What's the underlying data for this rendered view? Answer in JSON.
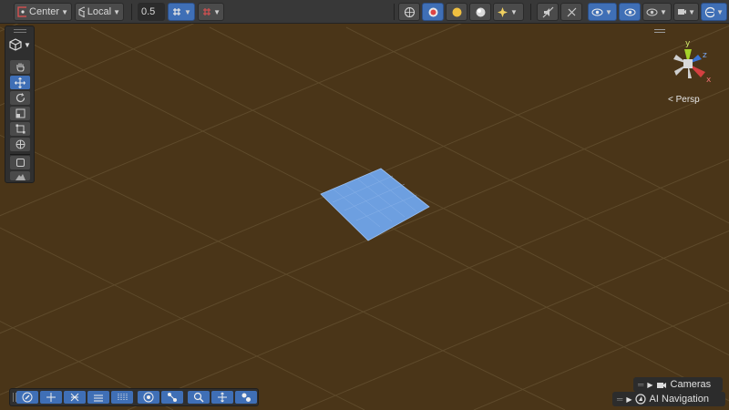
{
  "toolbar": {
    "pivot_mode": "Center",
    "pivot_rotation": "Local",
    "snap_value": "0.5"
  },
  "gizmo": {
    "projection_label": "Persp",
    "x_label": "x",
    "y_label": "y",
    "z_label": "z"
  },
  "overlays": {
    "cameras_label": "Cameras",
    "ai_navigation_label": "AI Navigation"
  },
  "colors": {
    "scene_background": "#4a3518",
    "grid_line": "#5f4a2c",
    "plane": "#6d9fe0",
    "active_button": "#3f6fb6",
    "toolbar": "#383838"
  }
}
